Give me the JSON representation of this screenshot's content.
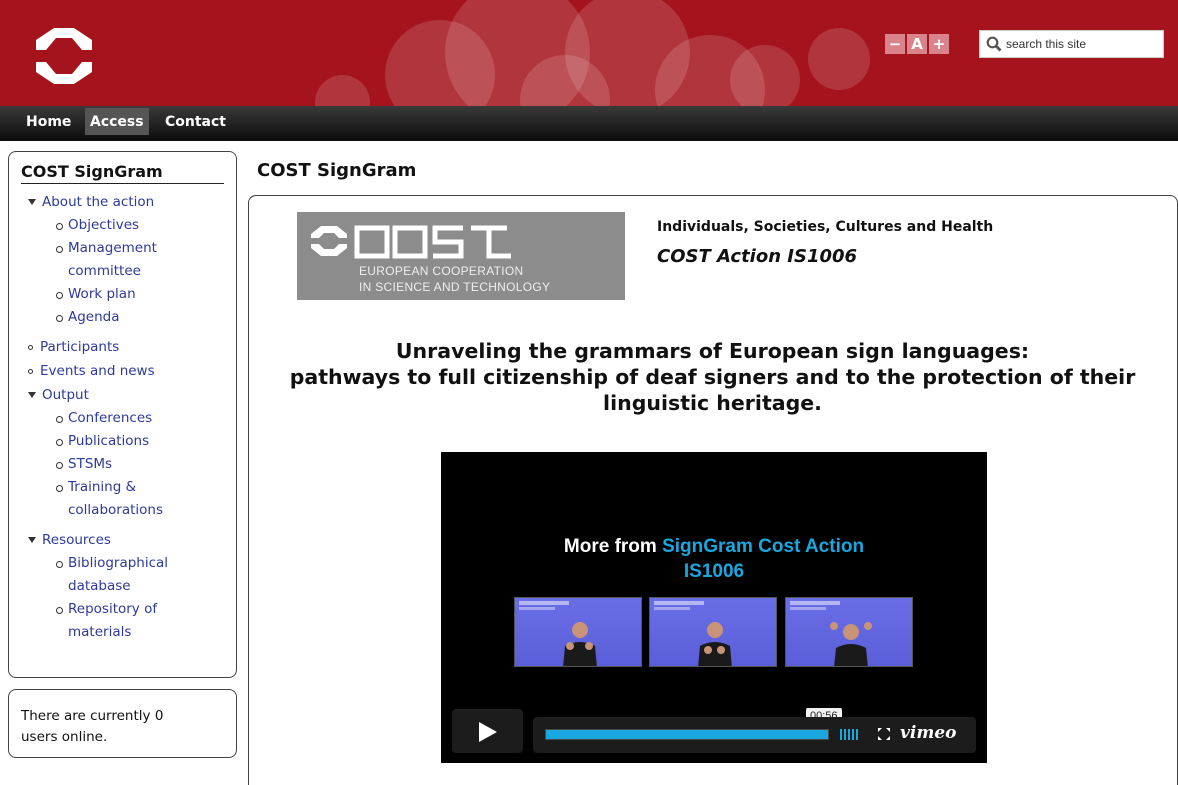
{
  "header": {
    "font_controls": [
      "−",
      "A",
      "+"
    ],
    "search": {
      "placeholder": "search this site",
      "value": ""
    },
    "brand_color": "#a5141c"
  },
  "nav": {
    "items": [
      {
        "label": "Home",
        "active": false
      },
      {
        "label": "Access",
        "active": true
      },
      {
        "label": "Contact",
        "active": false
      }
    ]
  },
  "sidebar": {
    "title": "COST SignGram",
    "menu": {
      "about": "About the action",
      "objectives": "Objectives",
      "management_1": "Management",
      "management_2": "committee",
      "work_plan": "Work plan",
      "agenda": "Agenda",
      "participants": "Participants",
      "events": "Events and news",
      "output": "Output",
      "conferences": "Conferences",
      "publications": "Publications",
      "stsms": "STSMs",
      "training_1": "Training &",
      "training_2": "collaborations",
      "resources": "Resources",
      "biblio_1": "Bibliographical",
      "biblio_2": "database",
      "repo_1": "Repository of",
      "repo_2": "materials"
    },
    "online_1": "There are currently 0",
    "online_2": "users online."
  },
  "main": {
    "title": "COST SignGram",
    "logo": {
      "sub1": "EUROPEAN COOPERATION",
      "sub2": "IN SCIENCE AND TECHNOLOGY"
    },
    "domain": "Individuals, Societies, Cultures and Health",
    "action": "COST Action IS1006",
    "headline_1": "Unraveling the grammars of European sign languages:",
    "headline_2": "pathways to full citizenship of deaf signers and to the protection of their",
    "headline_3": "linguistic heritage."
  },
  "video": {
    "more_from": "More from",
    "channel_1": "SignGram Cost Action",
    "channel_2": "IS1006",
    "time": "00:56",
    "brand": "vimeo",
    "accent_color": "#19a7e0"
  }
}
